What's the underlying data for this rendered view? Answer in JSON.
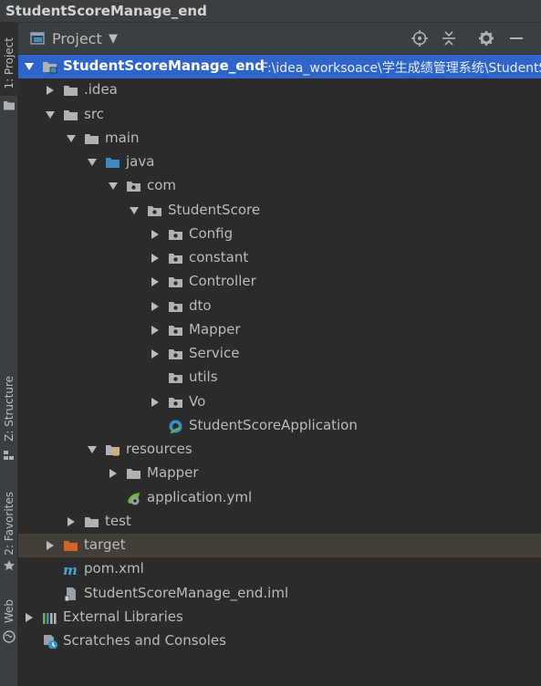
{
  "window": {
    "title": "StudentScoreManage_end"
  },
  "side_tabs": [
    {
      "label": "1: Project",
      "icon": "folder-icon"
    },
    {
      "label": "Z: Structure",
      "icon": "structure-icon"
    },
    {
      "label": "2: Favorites",
      "icon": "star-icon"
    },
    {
      "label": "Web",
      "icon": "globe-icon"
    }
  ],
  "toolbar": {
    "view_label": "Project",
    "icons": [
      "locate-icon",
      "collapse-all-icon",
      "gear-icon",
      "hide-icon"
    ]
  },
  "tree": [
    {
      "label": "StudentScoreManage_end",
      "path": "F:\\idea_worksoace\\学生成绩管理系统\\StudentS",
      "level": 0,
      "expanded": true,
      "icon": "module-folder-icon",
      "selected": true
    },
    {
      "label": ".idea",
      "level": 1,
      "expanded": false,
      "icon": "folder-icon"
    },
    {
      "label": "src",
      "level": 1,
      "expanded": true,
      "icon": "folder-icon"
    },
    {
      "label": "main",
      "level": 2,
      "expanded": true,
      "icon": "folder-icon"
    },
    {
      "label": "java",
      "level": 3,
      "expanded": true,
      "icon": "source-folder-icon"
    },
    {
      "label": "com",
      "level": 4,
      "expanded": true,
      "icon": "package-icon"
    },
    {
      "label": "StudentScore",
      "level": 5,
      "expanded": true,
      "icon": "package-icon"
    },
    {
      "label": "Config",
      "level": 6,
      "expanded": false,
      "icon": "package-icon"
    },
    {
      "label": "constant",
      "level": 6,
      "expanded": false,
      "icon": "package-icon"
    },
    {
      "label": "Controller",
      "level": 6,
      "expanded": false,
      "icon": "package-icon"
    },
    {
      "label": "dto",
      "level": 6,
      "expanded": false,
      "icon": "package-icon"
    },
    {
      "label": "Mapper",
      "level": 6,
      "expanded": false,
      "icon": "package-icon"
    },
    {
      "label": "Service",
      "level": 6,
      "expanded": false,
      "icon": "package-icon"
    },
    {
      "label": "utils",
      "level": 6,
      "expanded": null,
      "icon": "package-icon"
    },
    {
      "label": "Vo",
      "level": 6,
      "expanded": false,
      "icon": "package-icon"
    },
    {
      "label": "StudentScoreApplication",
      "level": 6,
      "expanded": null,
      "icon": "spring-boot-class-icon"
    },
    {
      "label": "resources",
      "level": 3,
      "expanded": true,
      "icon": "resources-folder-icon"
    },
    {
      "label": "Mapper",
      "level": 4,
      "expanded": false,
      "icon": "folder-icon"
    },
    {
      "label": "application.yml",
      "level": 4,
      "expanded": null,
      "icon": "spring-yml-icon"
    },
    {
      "label": "test",
      "level": 2,
      "expanded": false,
      "icon": "folder-icon"
    },
    {
      "label": "target",
      "level": 1,
      "expanded": false,
      "icon": "excluded-folder-icon",
      "highlighted": true
    },
    {
      "label": "pom.xml",
      "level": 1,
      "expanded": null,
      "icon": "maven-icon"
    },
    {
      "label": "StudentScoreManage_end.iml",
      "level": 1,
      "expanded": null,
      "icon": "iml-file-icon"
    },
    {
      "label": "External Libraries",
      "level": 0,
      "expanded": false,
      "icon": "libraries-icon"
    },
    {
      "label": "Scratches and Consoles",
      "level": 0,
      "expanded": null,
      "icon": "scratches-icon"
    }
  ]
}
